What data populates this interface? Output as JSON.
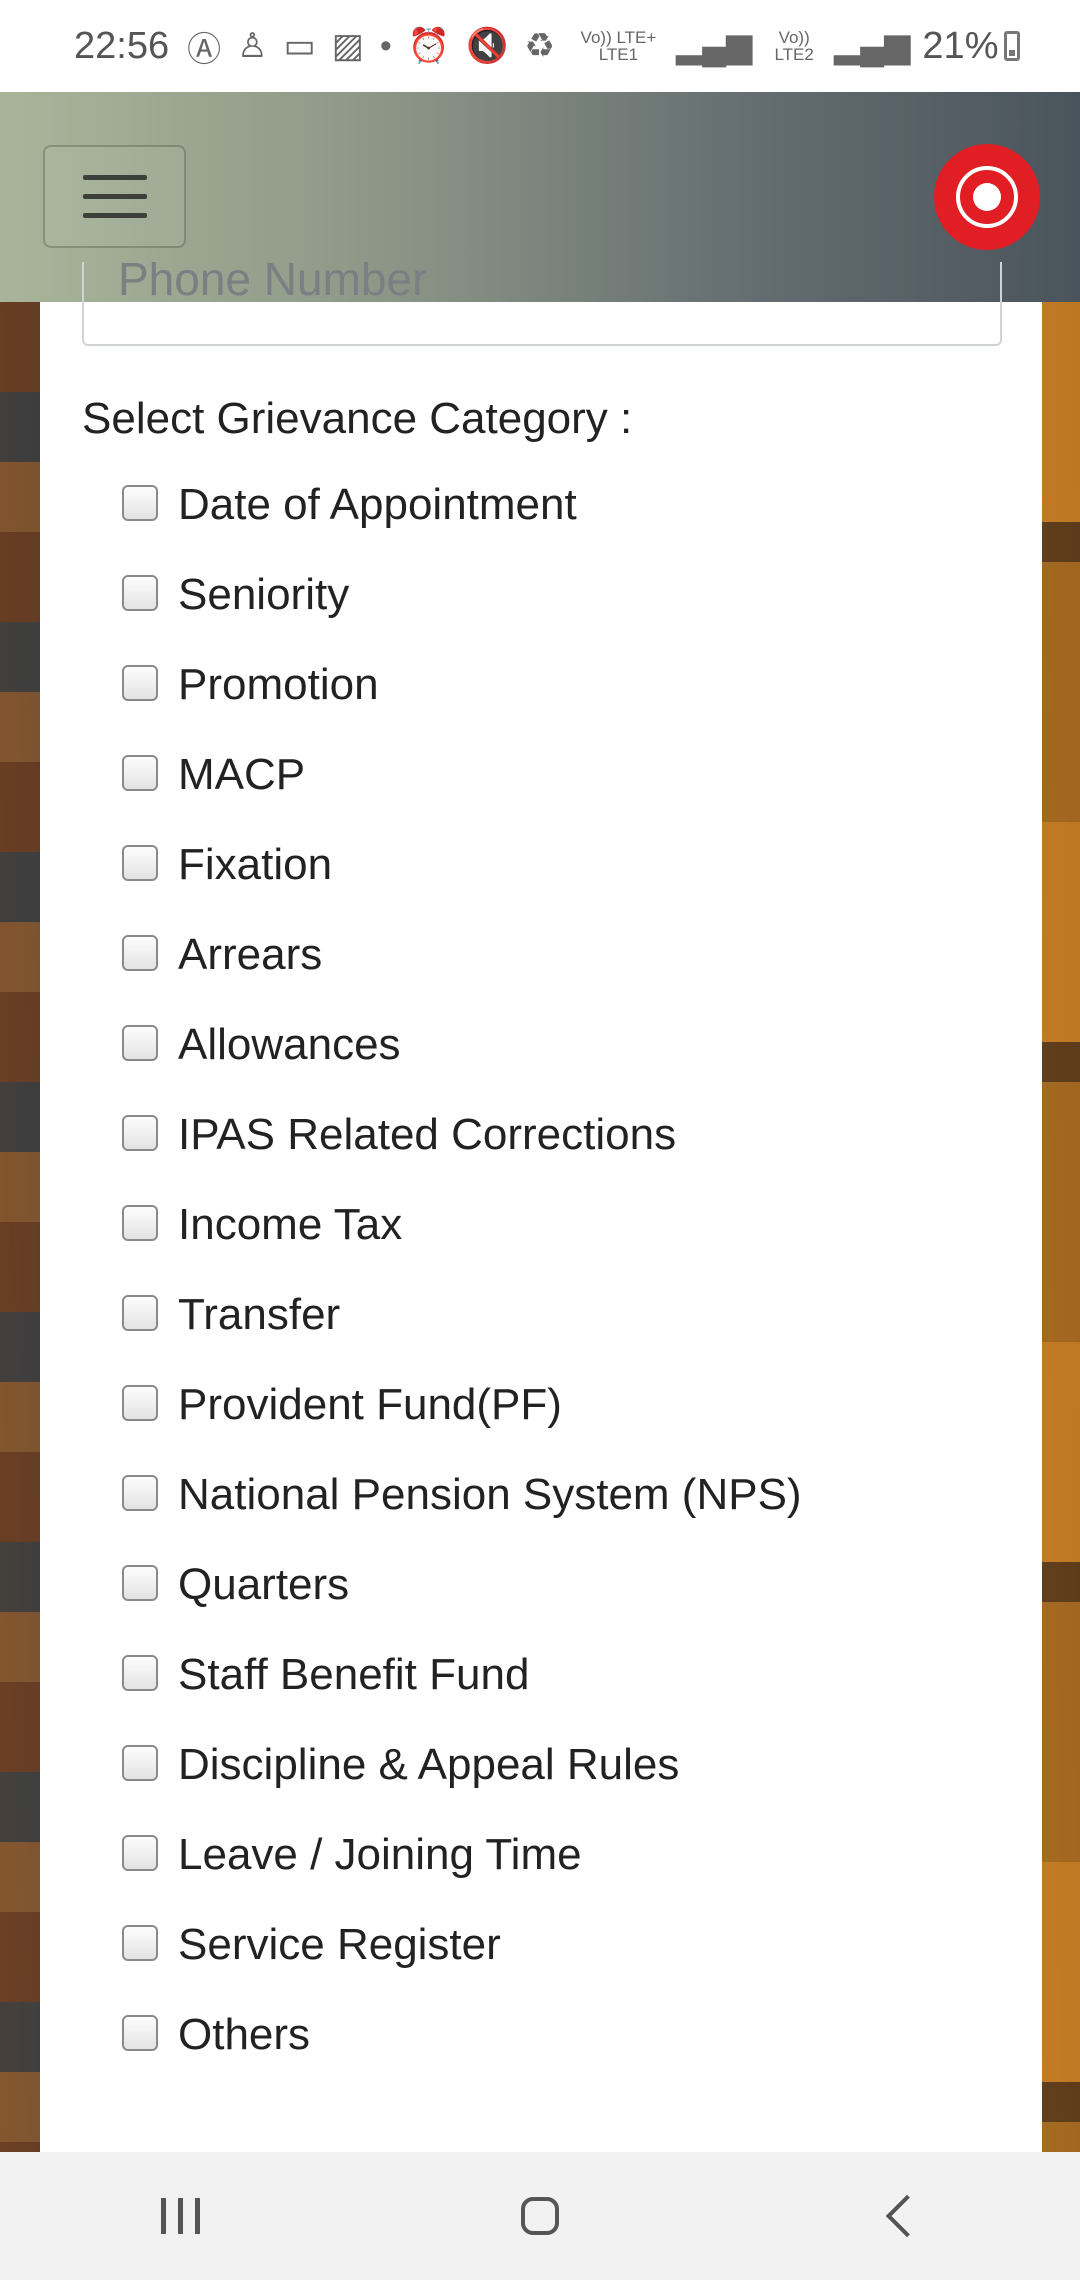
{
  "status_bar": {
    "time": "22:56",
    "network_1": "Vo)) LTE+ LTE1",
    "network_2": "Vo)) LTE2",
    "battery": "21%"
  },
  "header": {
    "menu_icon": "hamburger-icon",
    "logo": "indian-railways-logo"
  },
  "form": {
    "phone_placeholder": "Phone Number",
    "category_label": "Select Grievance Category :",
    "categories": [
      "Date of Appointment",
      "Seniority",
      "Promotion",
      "MACP",
      "Fixation",
      "Arrears",
      "Allowances",
      "IPAS Related Corrections",
      "Income Tax",
      "Transfer",
      "Provident Fund(PF)",
      "National Pension System (NPS)",
      "Quarters",
      "Staff Benefit Fund",
      "Discipline & Appeal Rules",
      "Leave / Joining Time",
      "Service Register",
      "Others"
    ]
  },
  "nav": {
    "recents_icon": "recents-icon",
    "home_icon": "home-icon",
    "back_icon": "back-icon"
  }
}
